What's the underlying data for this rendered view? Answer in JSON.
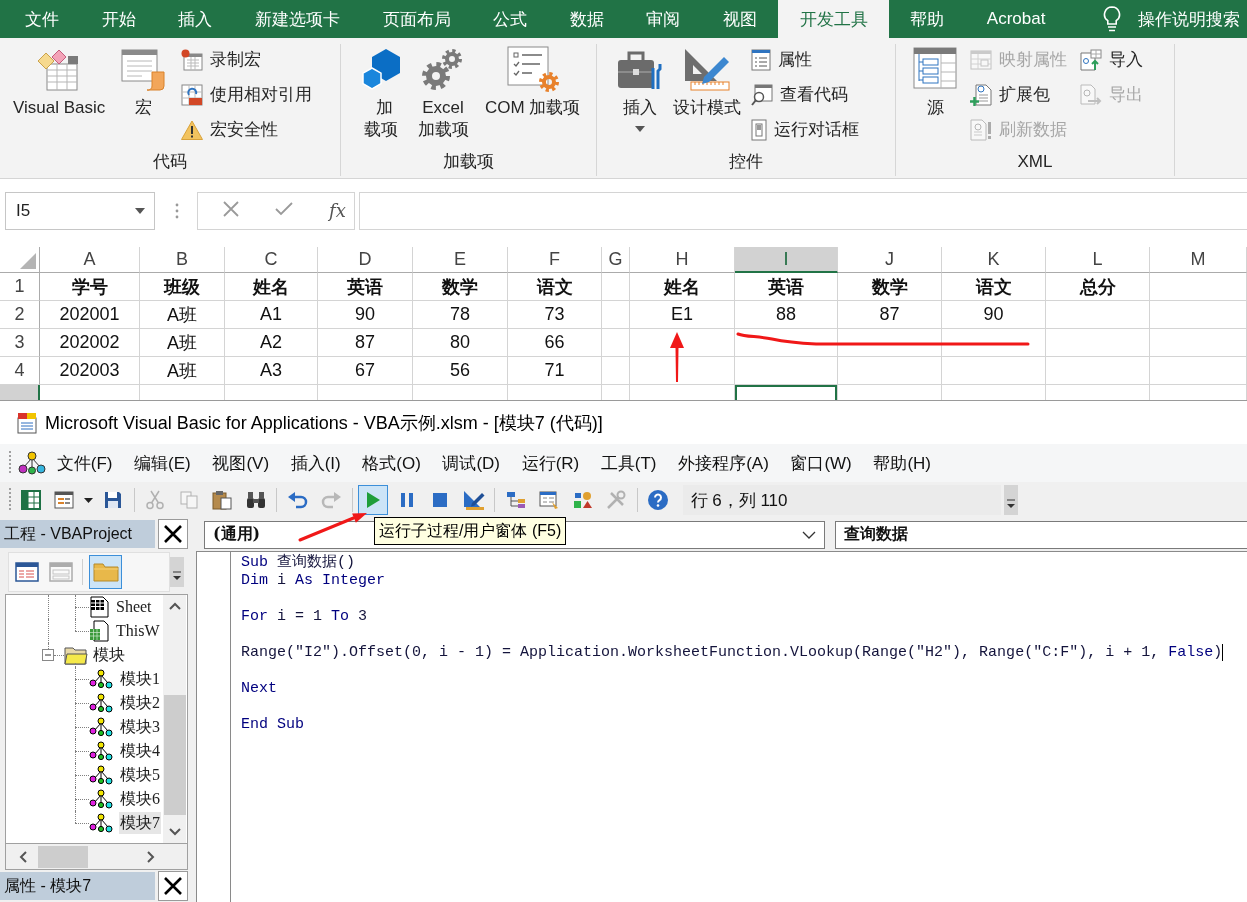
{
  "ribbon": {
    "tabs": [
      {
        "label": "文件",
        "selected": false
      },
      {
        "label": "开始",
        "selected": false
      },
      {
        "label": "插入",
        "selected": false
      },
      {
        "label": "新建选项卡",
        "selected": false
      },
      {
        "label": "页面布局",
        "selected": false
      },
      {
        "label": "公式",
        "selected": false
      },
      {
        "label": "数据",
        "selected": false
      },
      {
        "label": "审阅",
        "selected": false
      },
      {
        "label": "视图",
        "selected": false
      },
      {
        "label": "开发工具",
        "selected": true
      },
      {
        "label": "帮助",
        "selected": false
      },
      {
        "label": "Acrobat",
        "selected": false
      }
    ],
    "tell_me": "操作说明搜索",
    "groups": [
      {
        "label": "代码",
        "items": [
          {
            "kind": "large",
            "label": "Visual Basic",
            "disabled": false
          },
          {
            "kind": "large",
            "label": "宏",
            "disabled": false
          },
          {
            "kind": "column",
            "items": [
              {
                "label": "录制宏",
                "disabled": false
              },
              {
                "label": "使用相对引用",
                "disabled": false
              },
              {
                "label": "宏安全性",
                "disabled": false
              }
            ]
          }
        ]
      },
      {
        "label": "加载项",
        "items": [
          {
            "kind": "large",
            "label": "加载项",
            "disabled": false
          },
          {
            "kind": "large",
            "label": "Excel 加载项",
            "disabled": false
          },
          {
            "kind": "large",
            "label": "COM 加载项",
            "disabled": false
          }
        ]
      },
      {
        "label": "控件",
        "items": [
          {
            "kind": "large-menu",
            "label": "插入",
            "disabled": false
          },
          {
            "kind": "large",
            "label": "设计模式",
            "disabled": false
          },
          {
            "kind": "column",
            "items": [
              {
                "label": "属性",
                "disabled": false
              },
              {
                "label": "查看代码",
                "disabled": false
              },
              {
                "label": "运行对话框",
                "disabled": false
              }
            ]
          }
        ]
      },
      {
        "label": "XML",
        "items": [
          {
            "kind": "large",
            "label": "源",
            "disabled": false
          },
          {
            "kind": "column",
            "items": [
              {
                "label": "映射属性",
                "disabled": true
              },
              {
                "label": "扩展包",
                "disabled": false
              },
              {
                "label": "刷新数据",
                "disabled": true
              }
            ]
          },
          {
            "kind": "column",
            "items": [
              {
                "label": "导入",
                "disabled": false
              },
              {
                "label": "导出",
                "disabled": true
              }
            ]
          }
        ]
      }
    ]
  },
  "formula_bar": {
    "name_box": "I5",
    "function_button": "fx"
  },
  "sheet": {
    "columns": [
      {
        "label": "A",
        "selected": false
      },
      {
        "label": "B",
        "selected": false
      },
      {
        "label": "C",
        "selected": false
      },
      {
        "label": "D",
        "selected": false
      },
      {
        "label": "E",
        "selected": false
      },
      {
        "label": "F",
        "selected": false
      },
      {
        "label": "G",
        "selected": false
      },
      {
        "label": "H",
        "selected": false
      },
      {
        "label": "I",
        "selected": true
      },
      {
        "label": "J",
        "selected": false
      },
      {
        "label": "K",
        "selected": false
      },
      {
        "label": "L",
        "selected": false
      },
      {
        "label": "M",
        "selected": false
      }
    ],
    "rows": [
      {
        "header": "1",
        "kind": "header",
        "selected": false,
        "cells": [
          "学号",
          "班级",
          "姓名",
          "英语",
          "数学",
          "语文",
          null,
          "姓名",
          "英语",
          "数学",
          "语文",
          "总分"
        ]
      },
      {
        "header": "2",
        "kind": "data",
        "selected": false,
        "cells": [
          "202001",
          "A班",
          "A1",
          "90",
          "78",
          "73",
          null,
          "E1",
          "88",
          "87",
          "90"
        ]
      },
      {
        "header": "3",
        "kind": "data",
        "selected": false,
        "cells": [
          "202002",
          "A班",
          "A2",
          "87",
          "80",
          "66"
        ]
      },
      {
        "header": "4",
        "kind": "data",
        "selected": false,
        "cells": [
          "202003",
          "A班",
          "A3",
          "67",
          "56",
          "71"
        ]
      },
      {
        "kind": "data",
        "selected": true
      }
    ]
  },
  "vba": {
    "title": "Microsoft Visual Basic for Applications - VBA示例.xlsm - [模块7 (代码)]",
    "menus": [
      "文件(F)",
      "编辑(E)",
      "视图(V)",
      "插入(I)",
      "格式(O)",
      "调试(D)",
      "运行(R)",
      "工具(T)",
      "外接程序(A)",
      "窗口(W)",
      "帮助(H)"
    ],
    "toolbar": [
      {
        "kind": "button",
        "disabled": false,
        "hovered": false
      },
      {
        "kind": "split",
        "disabled": false,
        "hovered": false
      },
      {
        "kind": "button",
        "disabled": false,
        "hovered": false
      },
      {
        "kind": "separator"
      },
      {
        "kind": "button",
        "disabled": true,
        "hovered": false
      },
      {
        "kind": "button",
        "disabled": true,
        "hovered": false
      },
      {
        "kind": "button",
        "disabled": false,
        "hovered": false
      },
      {
        "kind": "button",
        "disabled": false,
        "hovered": false
      },
      {
        "kind": "separator"
      },
      {
        "kind": "button",
        "disabled": false,
        "hovered": false
      },
      {
        "kind": "button",
        "disabled": true,
        "hovered": false
      },
      {
        "kind": "separator"
      },
      {
        "kind": "button",
        "disabled": false,
        "hovered": true
      },
      {
        "kind": "button",
        "disabled": false,
        "hovered": false
      },
      {
        "kind": "button",
        "disabled": false,
        "hovered": false
      },
      {
        "kind": "button",
        "disabled": false,
        "hovered": false
      },
      {
        "kind": "separator"
      },
      {
        "kind": "button",
        "disabled": false,
        "hovered": false
      },
      {
        "kind": "button",
        "disabled": false,
        "hovered": false
      },
      {
        "kind": "button",
        "disabled": false,
        "hovered": false
      },
      {
        "kind": "button",
        "disabled": true,
        "hovered": false
      },
      {
        "kind": "separator"
      },
      {
        "kind": "button",
        "disabled": false,
        "hovered": false
      }
    ],
    "position": "行 6，列 110",
    "tooltip": "运行子过程/用户窗体 (F5)",
    "project_pane": {
      "title": "工程 - VBAProject",
      "toolbar": [
        {
          "disabled": false,
          "pressed": false
        },
        {
          "disabled": true,
          "pressed": false
        },
        {
          "disabled": false,
          "pressed": true
        }
      ],
      "tree": [
        {
          "kind": "offscreen",
          "children": [
            {
              "kind": "sheet",
              "label": "Sheet",
              "selected": false
            },
            {
              "kind": "workbook",
              "label": "ThisW",
              "selected": false
            }
          ]
        },
        {
          "kind": "folder",
          "label": "模块",
          "expanded": true,
          "selected": false,
          "children": [
            {
              "kind": "module",
              "label": "模块1",
              "selected": false
            },
            {
              "kind": "module",
              "label": "模块2",
              "selected": false
            },
            {
              "kind": "module",
              "label": "模块3",
              "selected": false
            },
            {
              "kind": "module",
              "label": "模块4",
              "selected": false
            },
            {
              "kind": "module",
              "label": "模块5",
              "selected": false
            },
            {
              "kind": "module",
              "label": "模块6",
              "selected": false
            },
            {
              "kind": "module",
              "label": "模块7",
              "selected": true
            }
          ]
        }
      ]
    },
    "properties_pane": {
      "title": "属性 - 模块7"
    },
    "code_pane": {
      "object": "(通用)",
      "procedure": "查询数据",
      "lines": [
        {
          "kind": "code",
          "caret": false,
          "tokens": [
            {
              "kind": "keyword",
              "text": "Sub"
            },
            {
              "kind": "plain",
              "text": " 查询数据()"
            }
          ]
        },
        {
          "kind": "code",
          "caret": false,
          "tokens": [
            {
              "kind": "keyword",
              "text": "Dim"
            },
            {
              "kind": "plain",
              "text": " i "
            },
            {
              "kind": "keyword",
              "text": "As Integer"
            }
          ]
        },
        {
          "kind": "blank"
        },
        {
          "kind": "code",
          "caret": false,
          "tokens": [
            {
              "kind": "keyword",
              "text": "For"
            },
            {
              "kind": "plain",
              "text": " i = 1 "
            },
            {
              "kind": "keyword",
              "text": "To"
            },
            {
              "kind": "plain",
              "text": " 3"
            }
          ]
        },
        {
          "kind": "blank"
        },
        {
          "kind": "code",
          "caret": true,
          "tokens": [
            {
              "kind": "plain",
              "text": "Range(\"I2\").Offset(0, i - 1) = Application.WorksheetFunction.VLookup(Range(\"H2\"), Range(\"C:F\"), i + 1, "
            },
            {
              "kind": "keyword",
              "text": "False"
            },
            {
              "kind": "plain",
              "text": ")"
            }
          ]
        },
        {
          "kind": "blank"
        },
        {
          "kind": "code",
          "caret": false,
          "tokens": [
            {
              "kind": "keyword",
              "text": "Next"
            }
          ]
        },
        {
          "kind": "blank"
        },
        {
          "kind": "code",
          "caret": false,
          "tokens": [
            {
              "kind": "keyword",
              "text": "End Sub"
            }
          ]
        }
      ]
    }
  }
}
